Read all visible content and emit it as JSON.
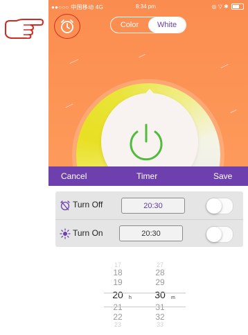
{
  "status_bar": {
    "carrier": "●●○○○ 中国移动 4G",
    "time": "8:34 pm"
  },
  "mode_toggle": {
    "color_label": "Color",
    "white_label": "White",
    "selected": "White"
  },
  "timer_bar": {
    "cancel_label": "Cancel",
    "title": "Timer",
    "save_label": "Save"
  },
  "turn_off": {
    "label": "Turn Off",
    "time": "20:30",
    "enabled": false
  },
  "turn_on": {
    "label": "Turn On",
    "time": "20:30",
    "enabled": false
  },
  "picker": {
    "hours": {
      "above2": "17",
      "above1a": "18",
      "above1b": "19",
      "selected": "20",
      "below1a": "21",
      "below1b": "22",
      "below2": "23",
      "unit": "h"
    },
    "minutes": {
      "above2": "27",
      "above1a": "28",
      "above1b": "29",
      "selected": "30",
      "below1a": "31",
      "below1b": "32",
      "below2": "33",
      "unit": "m"
    }
  },
  "colors": {
    "accent": "#6d40ad",
    "background": "#fb8c4f",
    "power_green": "#4fbc3c",
    "highlight_ring": "#d42a20"
  },
  "icons": {
    "pointer": "pointing-hand-icon",
    "alarm": "alarm-clock-icon",
    "power": "power-icon",
    "off": "alarm-off-icon",
    "on": "sun-icon"
  }
}
